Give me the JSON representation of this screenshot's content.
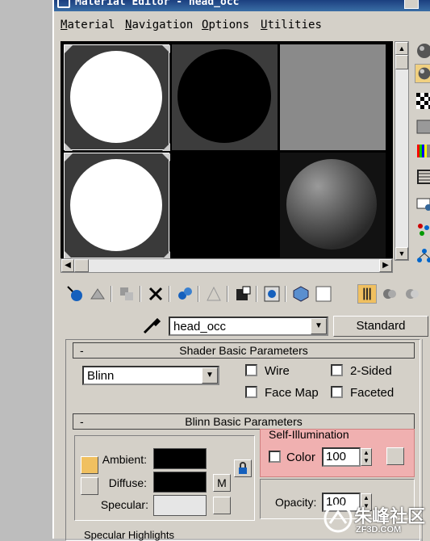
{
  "window": {
    "title": "Material Editor - head_occ"
  },
  "menu": [
    "Material",
    "Navigation",
    "Options",
    "Utilities"
  ],
  "material_name": "head_occ",
  "material_type_button": "Standard",
  "shader_rollout": {
    "title": "Shader Basic Parameters",
    "collapse": "-",
    "shader": "Blinn",
    "wire": "Wire",
    "two_sided": "2-Sided",
    "face_map": "Face Map",
    "faceted": "Faceted"
  },
  "blinn_rollout": {
    "title": "Blinn Basic Parameters",
    "collapse": "-",
    "ambient": "Ambient:",
    "diffuse": "Diffuse:",
    "specular": "Specular:",
    "map_btn": "M",
    "self_illum_title": "Self-Illumination",
    "color_label": "Color",
    "color_value": "100",
    "opacity_label": "Opacity:",
    "opacity_value": "100",
    "specular_highlights": "Specular Highlights"
  },
  "colors": {
    "ambient": "#000000",
    "diffuse": "#000000",
    "specular": "#e6e6e6",
    "highlight": "#f0b0b0"
  },
  "watermark": {
    "text": "朱峰社区",
    "sub": "ZF3D.COM"
  },
  "icons": [
    "sphere-icon",
    "backlight-icon",
    "checker-icon",
    "bg-icon",
    "color-icon",
    "video-icon",
    "options-icon",
    "select-by-material-icon",
    "material-map-navigator-icon"
  ]
}
